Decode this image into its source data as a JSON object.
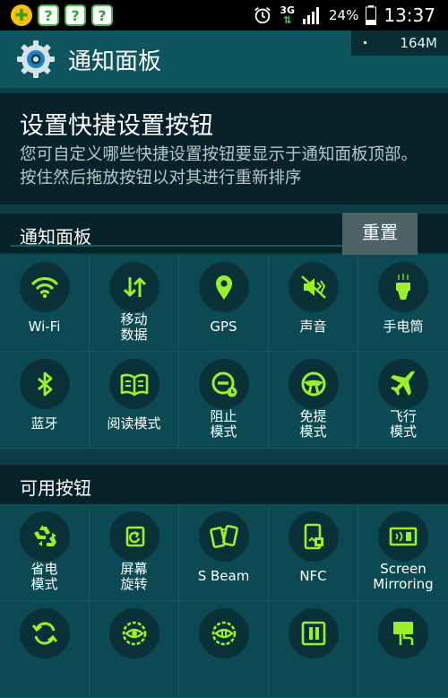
{
  "status_bar": {
    "time": "13:37",
    "battery": "24%",
    "network": "3G",
    "notification_icons": [
      "plus-icon",
      "question-icon",
      "question-icon",
      "question-icon"
    ]
  },
  "header": {
    "title": "通知面板",
    "memory": "164M"
  },
  "description": {
    "heading": "设置快捷设置按钮",
    "text": "您可自定义哪些快捷设置按钮要显示于通知面板顶部。按住然后拖放按钮以对其进行重新排序"
  },
  "panel_section": {
    "label": "通知面板",
    "reset_label": "重置"
  },
  "panel_buttons": [
    {
      "label": "Wi-Fi",
      "icon": "wifi-icon"
    },
    {
      "label": "移动\n数据",
      "icon": "mobile-data-icon"
    },
    {
      "label": "GPS",
      "icon": "gps-icon"
    },
    {
      "label": "声音",
      "icon": "sound-icon"
    },
    {
      "label": "手电筒",
      "icon": "flashlight-icon"
    },
    {
      "label": "蓝牙",
      "icon": "bluetooth-icon"
    },
    {
      "label": "阅读模式",
      "icon": "reading-mode-icon"
    },
    {
      "label": "阻止\n模式",
      "icon": "blocking-mode-icon"
    },
    {
      "label": "免提\n模式",
      "icon": "driving-mode-icon"
    },
    {
      "label": "飞行\n模式",
      "icon": "airplane-icon"
    }
  ],
  "available_section": {
    "label": "可用按钮"
  },
  "available_buttons": [
    {
      "label": "省电\n模式",
      "icon": "recycle-icon"
    },
    {
      "label": "屏幕\n旋转",
      "icon": "screen-rotation-icon"
    },
    {
      "label": "S Beam",
      "icon": "s-beam-icon"
    },
    {
      "label": "NFC",
      "icon": "nfc-icon"
    },
    {
      "label": "Screen\nMirroring",
      "icon": "screen-mirroring-icon"
    },
    {
      "label": "",
      "icon": "sync-icon"
    },
    {
      "label": "",
      "icon": "smart-stay-icon"
    },
    {
      "label": "",
      "icon": "smart-pause-icon"
    },
    {
      "label": "",
      "icon": "private-mode-icon"
    },
    {
      "label": "",
      "icon": "touch-icon"
    }
  ],
  "colors": {
    "accent_green": "#9cef2b",
    "background": "#0c4a53",
    "header": "#0f5560"
  }
}
